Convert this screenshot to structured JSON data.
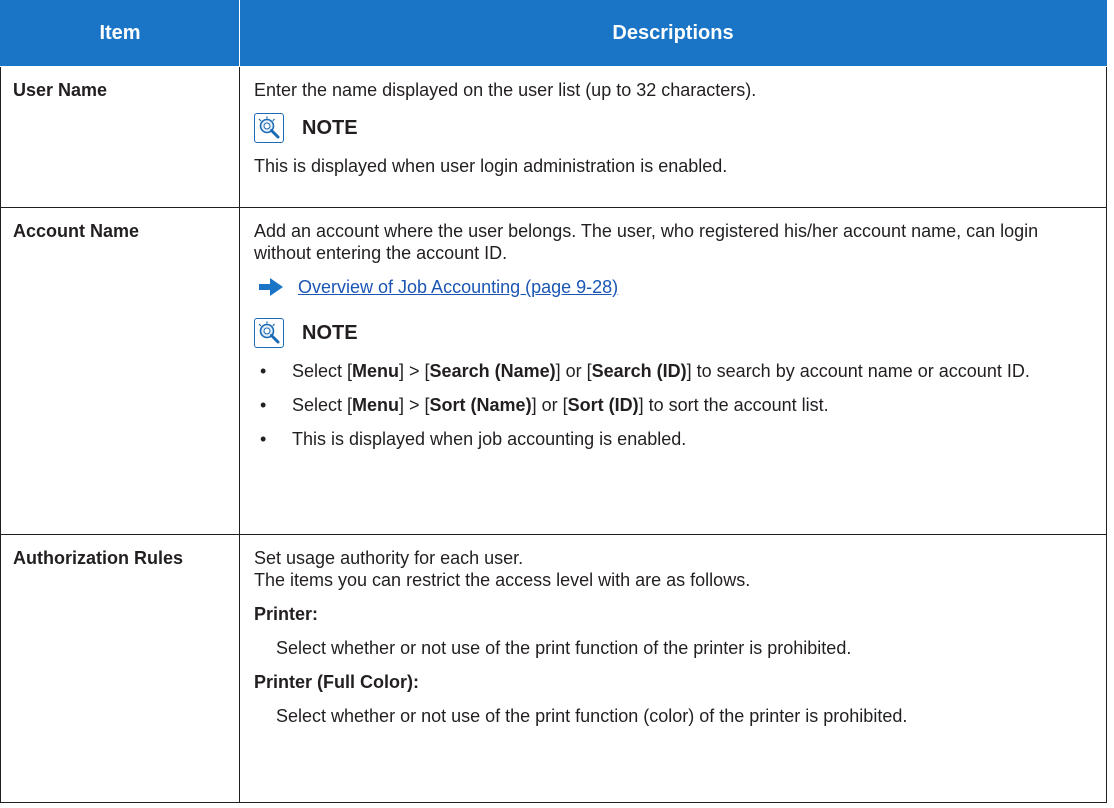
{
  "header": {
    "item": "Item",
    "descriptions": "Descriptions"
  },
  "rows": [
    {
      "item": "User Name",
      "desc": "Enter the name displayed on the user list (up to 32 characters).",
      "note_label": "NOTE",
      "note_text": "This is displayed when user login administration is enabled."
    },
    {
      "item": "Account Name",
      "desc": "Add an account where the user belongs. The user, who registered his/her account name, can login without entering the account ID.",
      "link": "Overview of Job Accounting (page 9-28)",
      "note_label": "NOTE",
      "bullets": [
        {
          "parts": [
            "Select [",
            "Menu",
            "] > [",
            "Search (Name)",
            "] or [",
            "Search (ID)",
            "] to search by account name or account ID."
          ]
        },
        {
          "parts": [
            "Select [",
            "Menu",
            "] > [",
            "Sort (Name)",
            "] or [",
            "Sort (ID)",
            "] to sort the account list."
          ]
        },
        {
          "text": "This is displayed when job accounting is enabled."
        }
      ]
    },
    {
      "item": "Authorization Rules",
      "desc_line1": "Set usage authority for each user.",
      "desc_line2": "The items you can restrict the access level with are as follows.",
      "sub": [
        {
          "head": "Printer:",
          "body": "Select whether or not use of the print function of the printer is prohibited."
        },
        {
          "head": "Printer (Full Color):",
          "body": "Select whether or not use of the print function (color) of the printer is prohibited."
        }
      ]
    }
  ],
  "colors": {
    "header_bg": "#1a75c7",
    "link": "#1b56b5",
    "note_icon": "#1a6bb5"
  },
  "icons": {
    "note": "lightbulb-note-icon",
    "link_arrow": "right-arrow-icon",
    "bullet": "bullet-dot"
  }
}
